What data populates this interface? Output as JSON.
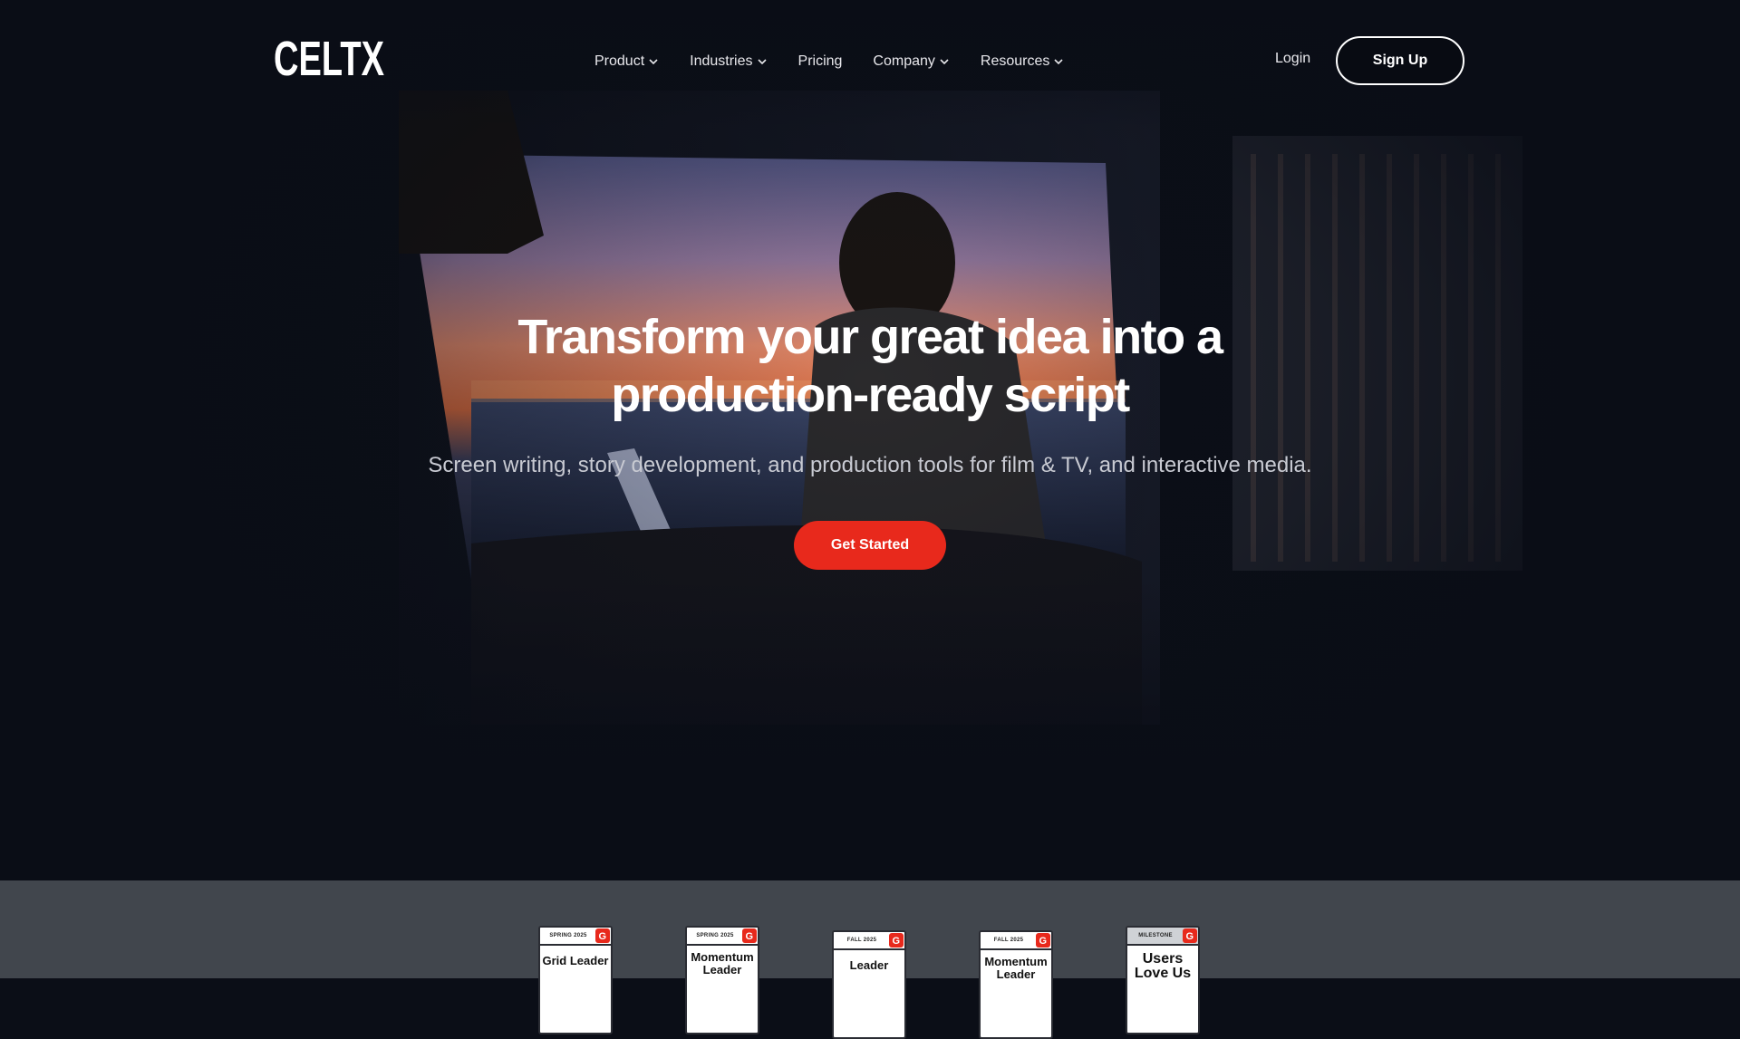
{
  "brand": {
    "logo_text": "CELTX",
    "accent": "#e8291c"
  },
  "nav": {
    "items": [
      {
        "label": "Product",
        "dropdown": true
      },
      {
        "label": "Industries",
        "dropdown": true
      },
      {
        "label": "Pricing",
        "dropdown": false
      },
      {
        "label": "Company",
        "dropdown": true
      },
      {
        "label": "Resources",
        "dropdown": true
      }
    ],
    "login": "Login",
    "signup": "Sign Up"
  },
  "hero": {
    "headline_line1": "Transform your great idea into a",
    "headline_line2": "production-ready script",
    "subhead": "Screen writing, story development, and production tools for film & TV, and interactive media.",
    "cta": "Get Started"
  },
  "badges": [
    {
      "season": "SPRING 2025",
      "title_line1": "Grid Leader",
      "title_line2": "",
      "icon": "g2-icon"
    },
    {
      "season": "SPRING 2025",
      "title_line1": "Momentum",
      "title_line2": "Leader",
      "icon": "g2-icon"
    },
    {
      "season": "FALL 2025",
      "title_line1": "Leader",
      "title_line2": "",
      "icon": "g2-icon"
    },
    {
      "season": "FALL 2025",
      "title_line1": "Momentum",
      "title_line2": "Leader",
      "icon": "g2-icon"
    },
    {
      "season": "MILESTONE",
      "title_line1": "Users",
      "title_line2": "Love Us",
      "icon": "g2-icon"
    }
  ]
}
